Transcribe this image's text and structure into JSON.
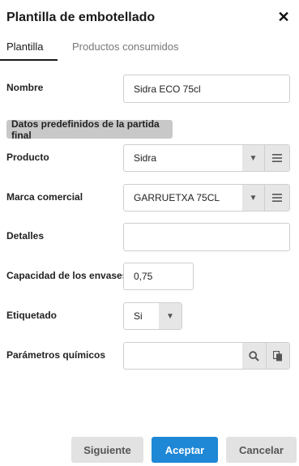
{
  "header": {
    "title": "Plantilla de embotellado",
    "close_glyph": "✕"
  },
  "tabs": [
    {
      "label": "Plantilla",
      "active": true
    },
    {
      "label": "Productos consumidos",
      "active": false
    }
  ],
  "form": {
    "nombre": {
      "label": "Nombre",
      "value": "Sidra ECO 75cl"
    },
    "section_title": "Datos predefinidos de la partida final",
    "producto": {
      "label": "Producto",
      "value": "Sidra"
    },
    "marca": {
      "label": "Marca comercial",
      "value": "GARRUETXA 75CL"
    },
    "detalles": {
      "label": "Detalles",
      "value": ""
    },
    "capacidad": {
      "label": "Capacidad de los envases",
      "value": "0,75"
    },
    "etiquetado": {
      "label": "Etiquetado",
      "value": "Si"
    },
    "parametros": {
      "label": "Parámetros químicos",
      "value": ""
    }
  },
  "footer": {
    "next_label": "Siguiente",
    "accept_label": "Aceptar",
    "cancel_label": "Cancelar"
  },
  "icons": {
    "close": "close-icon",
    "dropdown": "caret-down-icon",
    "list": "list-icon",
    "search": "search-icon",
    "copy": "copy-icon"
  },
  "colors": {
    "accent": "#1e88d6",
    "section_bg": "#c8c8c8",
    "button_secondary": "#e2e2e2"
  }
}
